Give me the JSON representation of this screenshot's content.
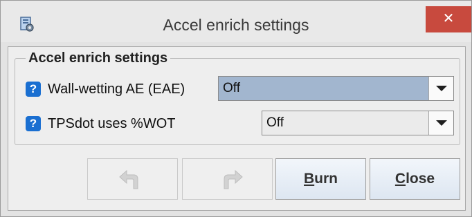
{
  "window": {
    "title": "Accel enrich settings",
    "app_icon": "gear-document-icon",
    "close_glyph": "✕"
  },
  "group": {
    "legend": "Accel enrich settings",
    "rows": [
      {
        "label": "Wall-wetting AE (EAE)",
        "help_glyph": "?",
        "value": "Off",
        "state": "focused"
      },
      {
        "label": "TPSdot uses %WOT",
        "help_glyph": "?",
        "value": "Off",
        "state": "normal"
      }
    ]
  },
  "buttons": {
    "undo_icon": "undo-arrow-icon",
    "redo_icon": "redo-arrow-icon",
    "burn": {
      "mnemonic": "B",
      "rest": "urn"
    },
    "close": {
      "mnemonic": "C",
      "rest": "lose"
    }
  },
  "colors": {
    "close_button": "#c84a3e",
    "help_icon": "#1a6fd1",
    "selected_field": "#a2b6cf"
  }
}
